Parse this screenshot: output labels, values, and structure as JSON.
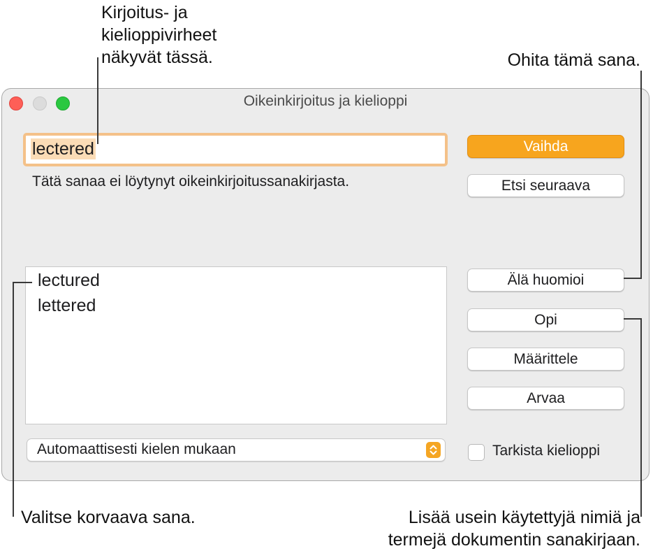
{
  "callouts": {
    "errors_line1": "Kirjoitus- ja",
    "errors_line2": "kielioppivirheet",
    "errors_line3": "näkyvät tässä.",
    "ignore": "Ohita tämä sana.",
    "choose": "Valitse korvaava sana.",
    "learn_line1": "Lisää usein käytettyjä nimiä ja",
    "learn_line2": "termejä dokumentin sanakirjaan."
  },
  "window": {
    "title": "Oikeinkirjoitus ja kielioppi",
    "misspelled_word": "lectered",
    "message": "Tätä sanaa ei löytynyt oikeinkirjoitussanakirjasta.",
    "buttons": {
      "change": "Vaihda",
      "find_next": "Etsi seuraava",
      "ignore": "Älä huomioi",
      "learn": "Opi",
      "define": "Määrittele",
      "guess": "Arvaa"
    },
    "suggestions": [
      "lectured",
      "lettered"
    ],
    "language_popup": "Automaattisesti kielen mukaan",
    "check_grammar_label": "Tarkista kielioppi",
    "check_grammar_checked": false
  },
  "colors": {
    "accent_orange": "#f7a51e",
    "focus_ring": "#f4c189",
    "close": "#fe5f57",
    "zoom": "#2ac840"
  }
}
